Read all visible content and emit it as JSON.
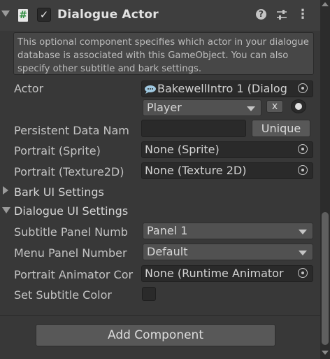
{
  "component": {
    "title": "Dialogue Actor",
    "script_icon_glyph": "#",
    "enabled_glyph": "✓",
    "help_glyph": "?",
    "menu_glyph": "⋮"
  },
  "helpbox": {
    "text": "This optional component specifies which actor in your dialogue database is associated with this GameObject. You can also specify other subtitle and bark settings."
  },
  "fields": {
    "actor": {
      "label": "Actor",
      "value": "BakewellIntro 1 (Dialog",
      "value_icon": "dialogue-database-icon"
    },
    "actor_popup": {
      "value": "Player",
      "clear_label": "x"
    },
    "persistent_data": {
      "label": "Persistent Data Nam",
      "value": "",
      "unique_label": "Unique"
    },
    "portrait_sprite": {
      "label": "Portrait (Sprite)",
      "value": "None (Sprite)"
    },
    "portrait_texture": {
      "label": "Portrait (Texture2D)",
      "value": "None (Texture 2D)"
    }
  },
  "foldouts": {
    "bark": {
      "label": "Bark UI Settings",
      "expanded": false
    },
    "dialogue": {
      "label": "Dialogue UI Settings",
      "expanded": true
    }
  },
  "dialogue_ui": {
    "subtitle_panel": {
      "label": "Subtitle Panel Numb",
      "value": "Panel 1"
    },
    "menu_panel": {
      "label": "Menu Panel Number",
      "value": "Default"
    },
    "portrait_animator": {
      "label": "Portrait Animator Cor",
      "value": "None (Runtime Animator"
    },
    "set_subtitle_color": {
      "label": "Set Subtitle Color",
      "checked": false
    }
  },
  "footer": {
    "add_component_label": "Add Component"
  },
  "colors": {
    "background": "#383838",
    "header": "#3e3e3e",
    "field": "#2a2a2a",
    "button": "#585858"
  }
}
